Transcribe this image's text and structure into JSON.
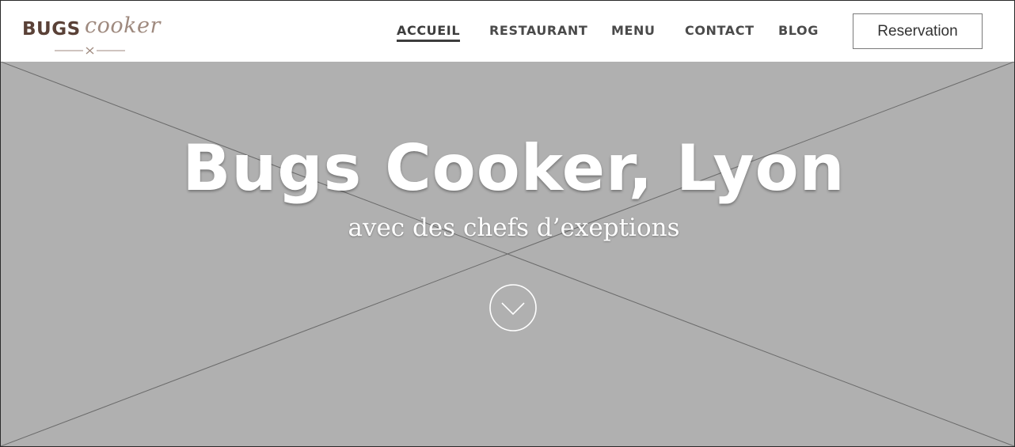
{
  "logo": {
    "primary": "BUGS",
    "secondary": "cooker"
  },
  "nav": {
    "items": [
      {
        "label": "ACCUEIL",
        "active": true
      },
      {
        "label": "RESTAURANT",
        "active": false
      },
      {
        "label": "MENU",
        "active": false
      },
      {
        "label": "CONTACT",
        "active": false
      },
      {
        "label": "BLOG",
        "active": false
      }
    ],
    "reservation_label": "Reservation"
  },
  "hero": {
    "title": "Bugs Cooker, Lyon",
    "subtitle": "avec des chefs d’exeptions",
    "scroll_icon": "chevron-down-circle-icon",
    "placeholder_image": "image-placeholder-cross"
  },
  "colors": {
    "brand_dark": "#5a4137",
    "brand_light": "#9f8a7f",
    "hero_background": "#b0b0b0",
    "nav_text": "#4a4a4a"
  }
}
